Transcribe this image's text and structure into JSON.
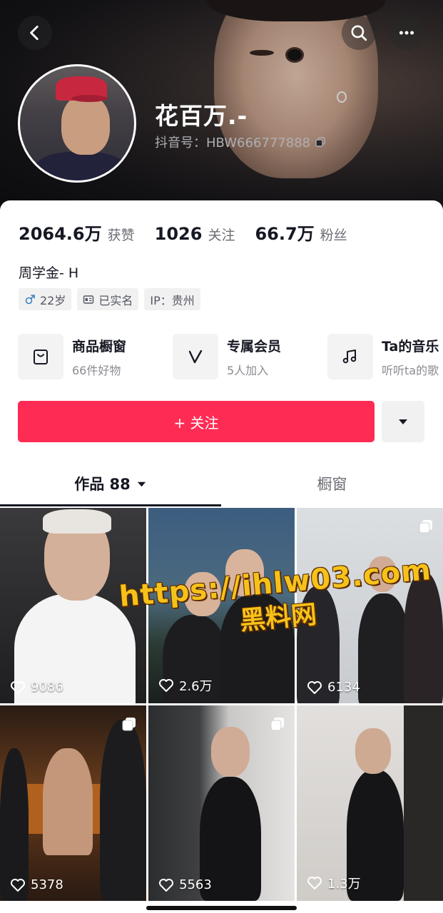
{
  "profile": {
    "name": "花百万.-",
    "douyin_id": "抖音号：HBW666777888",
    "bio": "周学金- H"
  },
  "stats": [
    {
      "value": "2064.6万",
      "label": "获赞"
    },
    {
      "value": "1026",
      "label": "关注"
    },
    {
      "value": "66.7万",
      "label": "粉丝"
    }
  ],
  "tags": [
    {
      "icon": "male-icon",
      "text": "22岁"
    },
    {
      "icon": "id-card-icon",
      "text": "已实名"
    },
    {
      "icon": "",
      "text": "IP：贵州"
    }
  ],
  "features": [
    {
      "icon": "shopping-bag-icon",
      "title": "商品橱窗",
      "subtitle": "66件好物"
    },
    {
      "icon": "vip-icon",
      "title": "专属会员",
      "subtitle": "5人加入"
    },
    {
      "icon": "music-note-icon",
      "title": "Ta的音乐",
      "subtitle": "听听ta的歌"
    }
  ],
  "actions": {
    "follow": "+ 关注"
  },
  "tabs": {
    "works": "作品 88",
    "window": "橱窗"
  },
  "videos": [
    {
      "likes": "9086"
    },
    {
      "likes": "2.6万"
    },
    {
      "likes": "6134"
    },
    {
      "likes": "5378"
    },
    {
      "likes": "5563"
    },
    {
      "likes": "1.3万"
    }
  ],
  "watermark": {
    "line1": "https://ihlw03.com",
    "line2": "黑料网"
  },
  "colors": {
    "accent": "#fe2c55",
    "text": "#161823",
    "watermark": "#f6c21a"
  }
}
